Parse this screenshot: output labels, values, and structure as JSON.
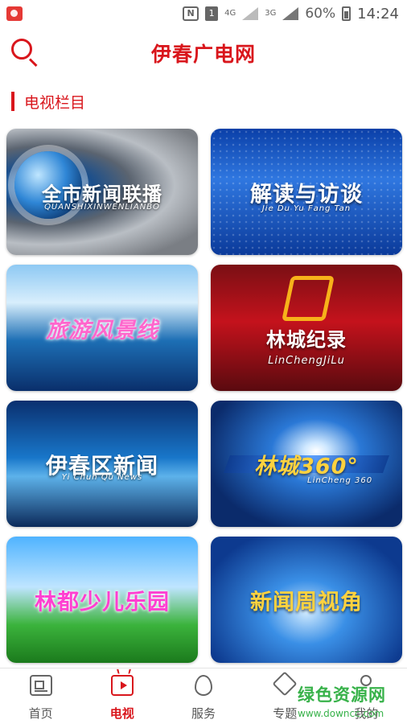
{
  "statusbar": {
    "net_top": "4G",
    "net_bottom": "3G",
    "battery": "60%",
    "time": "14:24",
    "sim": "1",
    "nfc": "N"
  },
  "header": {
    "title": "伊春广电网",
    "search_icon": "search-icon"
  },
  "section": {
    "title": "电视栏目"
  },
  "programs": [
    {
      "title": "全市新闻联播",
      "subtitle": "QUANSHIXINWENLIANBO"
    },
    {
      "title": "解读与访谈",
      "subtitle": "Jie Du Yu Fang Tan"
    },
    {
      "title": "旅游风景线",
      "subtitle": ""
    },
    {
      "title": "林城纪录",
      "subtitle": "LinChengJiLu"
    },
    {
      "title": "伊春区新闻",
      "subtitle": "Yi Chun Qu News"
    },
    {
      "title": "林城360°",
      "subtitle": "LinCheng 360"
    },
    {
      "title": "林都少儿乐园",
      "subtitle": ""
    },
    {
      "title": "新闻周视角",
      "subtitle": ""
    }
  ],
  "bottom_nav": [
    {
      "label": "首页",
      "icon": "home-icon"
    },
    {
      "label": "电视",
      "icon": "tv-icon",
      "active": true
    },
    {
      "label": "服务",
      "icon": "fire-icon"
    },
    {
      "label": "专题",
      "icon": "tag-icon"
    },
    {
      "label": "我的",
      "icon": "user-icon"
    }
  ],
  "watermark": {
    "main": "绿色资源网",
    "url": "www.downcc.com"
  },
  "colors": {
    "accent": "#d9161c",
    "watermark": "#38b24a"
  }
}
